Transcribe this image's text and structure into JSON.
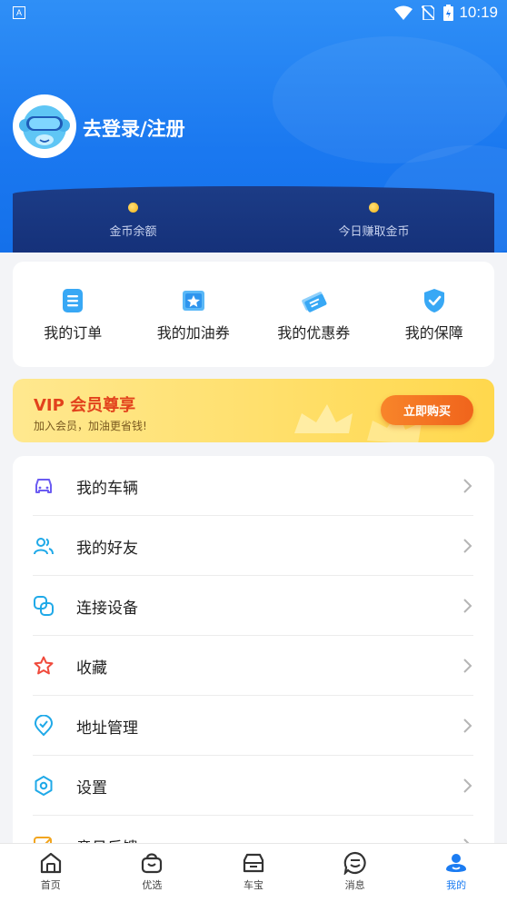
{
  "status_bar": {
    "indicator": "A",
    "time": "10:19"
  },
  "profile": {
    "login_text": "去登录/注册"
  },
  "coins": {
    "balance_label": "金币余额",
    "today_label": "今日赚取金币"
  },
  "quick_actions": [
    {
      "label": "我的订单",
      "icon": "order-icon"
    },
    {
      "label": "我的加油券",
      "icon": "fuel-coupon-icon"
    },
    {
      "label": "我的优惠券",
      "icon": "coupon-icon"
    },
    {
      "label": "我的保障",
      "icon": "shield-icon"
    }
  ],
  "vip": {
    "title": "VIP 会员尊享",
    "subtitle": "加入会员，加油更省钱!",
    "button": "立即购买"
  },
  "menu": [
    {
      "label": "我的车辆",
      "icon": "car-icon"
    },
    {
      "label": "我的好友",
      "icon": "friends-icon"
    },
    {
      "label": "连接设备",
      "icon": "link-device-icon"
    },
    {
      "label": "收藏",
      "icon": "star-icon"
    },
    {
      "label": "地址管理",
      "icon": "location-icon"
    },
    {
      "label": "设置",
      "icon": "settings-icon"
    },
    {
      "label": "意见反馈",
      "icon": "feedback-icon"
    }
  ],
  "tabs": [
    {
      "label": "首页",
      "icon": "home-icon"
    },
    {
      "label": "优选",
      "icon": "bag-icon"
    },
    {
      "label": "车宝",
      "icon": "car-treasure-icon"
    },
    {
      "label": "消息",
      "icon": "message-icon"
    },
    {
      "label": "我的",
      "icon": "mine-icon",
      "active": true
    }
  ],
  "colors": {
    "primary": "#1b7cf2",
    "vip_title": "#e2421c",
    "buy_button": "#f0641c"
  }
}
